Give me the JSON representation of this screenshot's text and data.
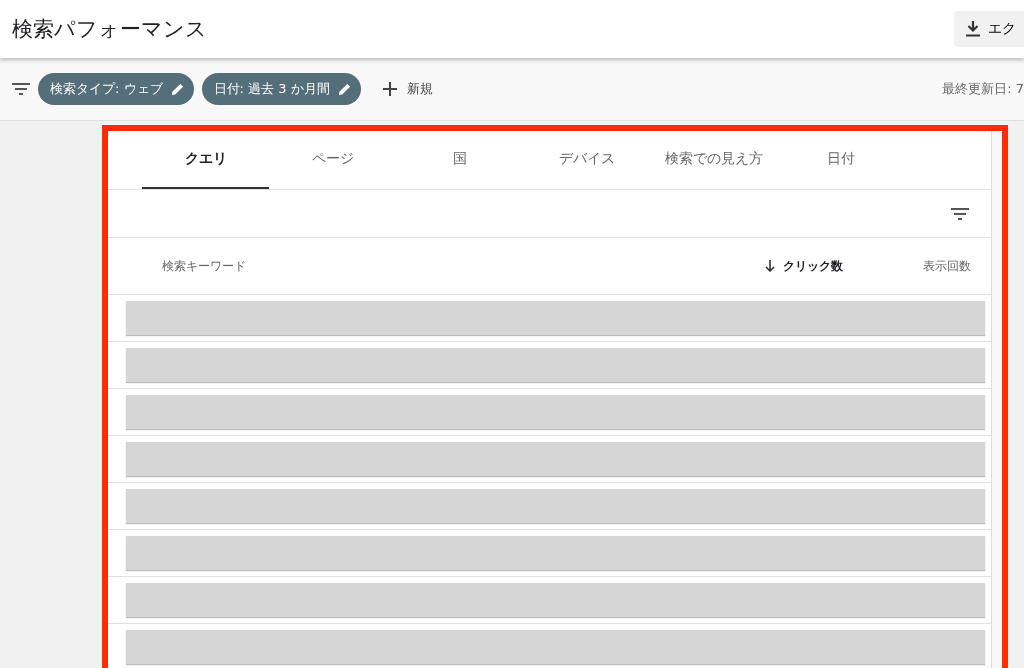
{
  "header": {
    "title": "検索パフォーマンス",
    "export_button": "エク"
  },
  "filter_bar": {
    "chips": [
      {
        "label": "検索タイプ: ウェブ"
      },
      {
        "label": "日付: 過去 3 か月間"
      }
    ],
    "new_button": "新規",
    "last_updated": "最終更新日: 7"
  },
  "tabs": [
    {
      "label": "クエリ",
      "selected": true
    },
    {
      "label": "ページ",
      "selected": false
    },
    {
      "label": "国",
      "selected": false
    },
    {
      "label": "デバイス",
      "selected": false
    },
    {
      "label": "検索での見え方",
      "selected": false
    },
    {
      "label": "日付",
      "selected": false
    }
  ],
  "table": {
    "columns": [
      {
        "label": "検索キーワード",
        "sorted": false
      },
      {
        "label": "クリック数",
        "sorted": true
      },
      {
        "label": "表示回数",
        "sorted": false
      }
    ],
    "rows": [
      {
        "kind": "redacted"
      },
      {
        "kind": "redacted"
      },
      {
        "kind": "redacted"
      },
      {
        "kind": "redacted"
      },
      {
        "kind": "redacted"
      },
      {
        "kind": "redacted"
      },
      {
        "kind": "redacted"
      },
      {
        "kind": "redacted"
      }
    ]
  }
}
